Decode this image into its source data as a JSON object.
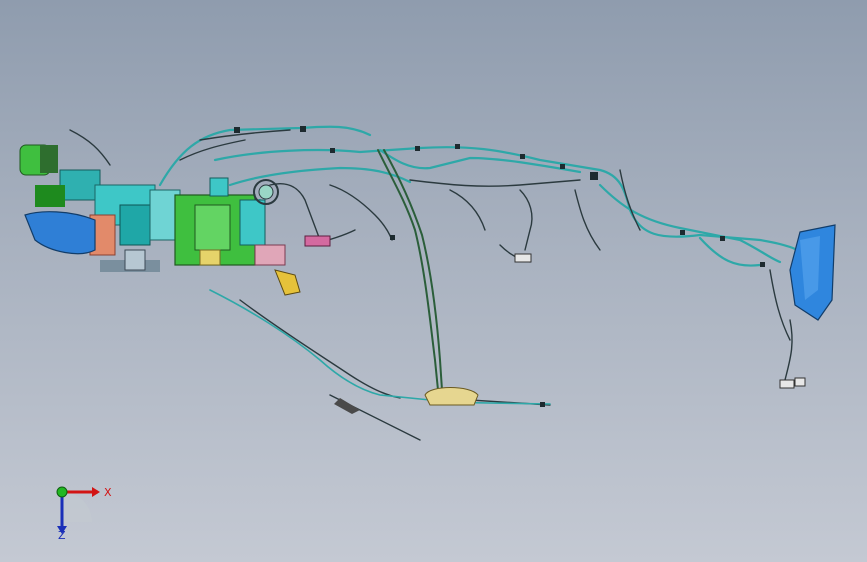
{
  "viewport": {
    "background_top": "#8f9cae",
    "background_bottom": "#c4c9d3"
  },
  "model": {
    "wire_color": "#2ea8a8",
    "dark_wire_color": "#2b3a3f",
    "left_housing_color": "#2f7fd6",
    "right_housing_color": "#2f86de",
    "green_component_color": "#3fbf3f",
    "yellow_component_color": "#e6d36a",
    "pink_component_color": "#e0a6b8"
  },
  "axis_triad": {
    "x_label": "X",
    "z_label": "Z",
    "x_color": "#d21414",
    "y_color": "#22b822",
    "z_color": "#1a2fb8"
  }
}
